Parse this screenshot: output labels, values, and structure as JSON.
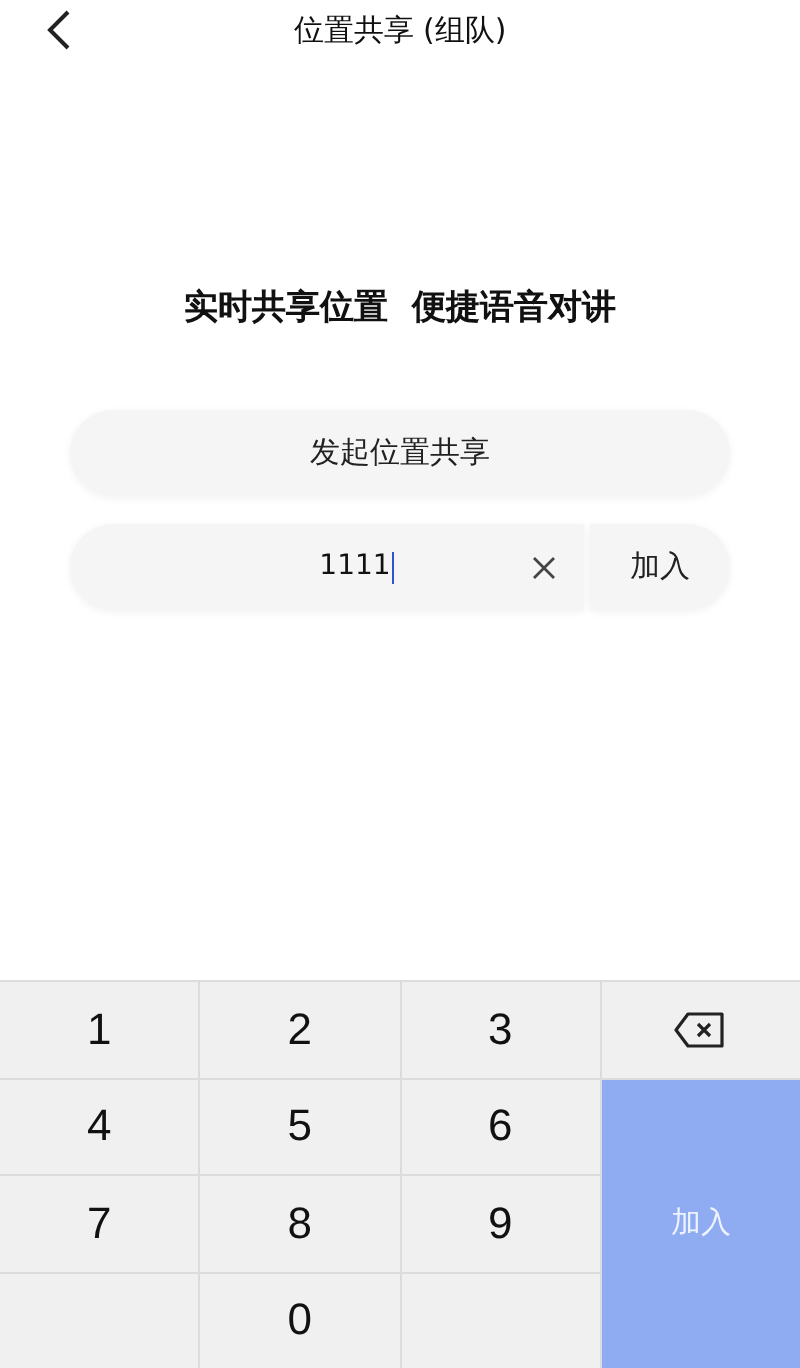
{
  "nav": {
    "title": "位置共享 (组队)"
  },
  "headline": "实时共享位置  便捷语音对讲",
  "start_button": "发起位置共享",
  "join": {
    "value": "1111",
    "button": "加入"
  },
  "keyboard": {
    "keys": [
      {
        "kind": "digit",
        "label": "1"
      },
      {
        "kind": "digit",
        "label": "2"
      },
      {
        "kind": "digit",
        "label": "3"
      },
      {
        "kind": "digit",
        "label": "4"
      },
      {
        "kind": "digit",
        "label": "5"
      },
      {
        "kind": "digit",
        "label": "6"
      },
      {
        "kind": "digit",
        "label": "7"
      },
      {
        "kind": "digit",
        "label": "8"
      },
      {
        "kind": "digit",
        "label": "9"
      },
      {
        "kind": "blank"
      },
      {
        "kind": "digit",
        "label": "0"
      },
      {
        "kind": "blank"
      }
    ],
    "confirm": {
      "label": "加入",
      "disabled": true
    }
  }
}
